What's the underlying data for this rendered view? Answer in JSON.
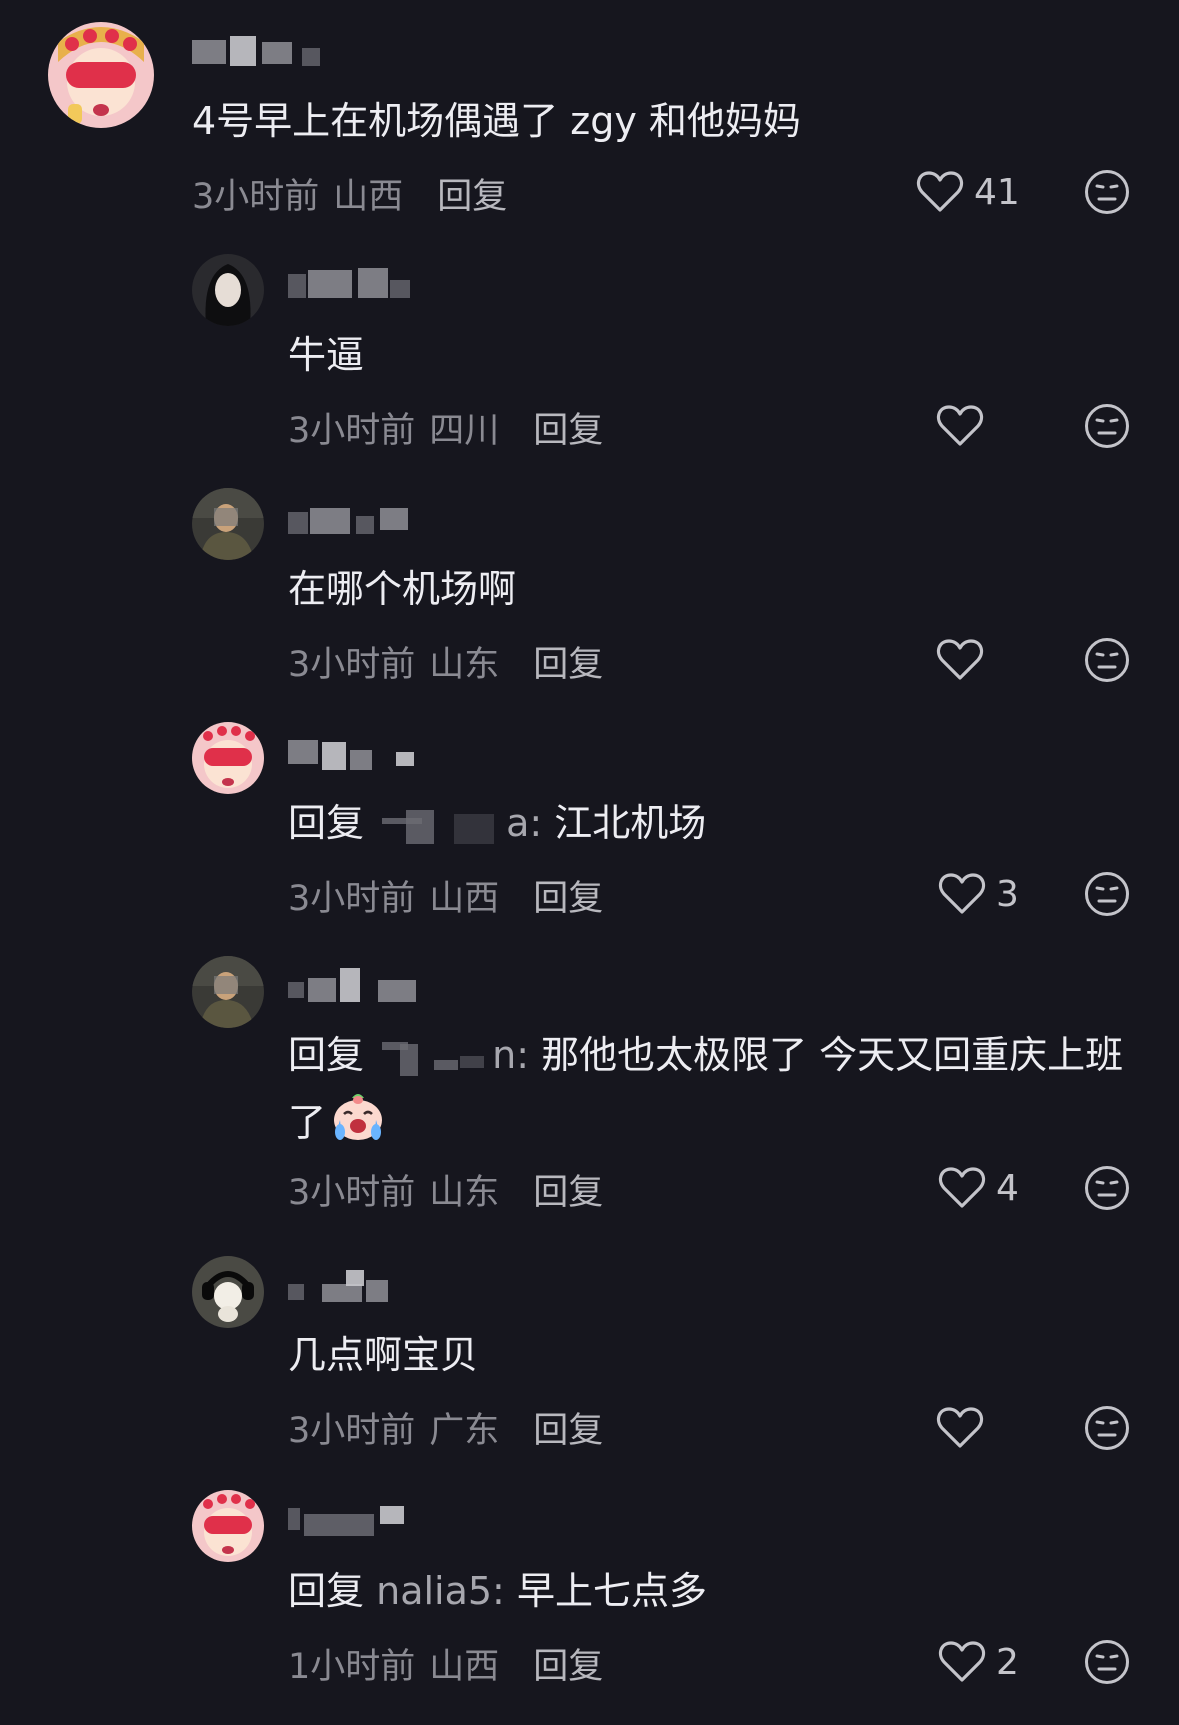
{
  "comments": [
    {
      "text": "4号早上在机场偶遇了 zgy 和他妈妈",
      "time": "3小时前",
      "location": "山西",
      "reply_label": "回复",
      "likes": "41"
    }
  ],
  "replies": [
    {
      "text": "牛逼",
      "time": "3小时前",
      "location": "四川",
      "reply_label": "回复",
      "likes": ""
    },
    {
      "text": "在哪个机场啊",
      "time": "3小时前",
      "location": "山东",
      "reply_label": "回复",
      "likes": ""
    },
    {
      "prefix": "回复",
      "mention_suffix": "a: ",
      "text": "江北机场",
      "time": "3小时前",
      "location": "山西",
      "reply_label": "回复",
      "likes": "3"
    },
    {
      "prefix": "回复",
      "mention_suffix": "n: ",
      "text": "那他也太极限了 今天又回重庆上班了",
      "emoji": "crying-face-emoji",
      "time": "3小时前",
      "location": "山东",
      "reply_label": "回复",
      "likes": "4"
    },
    {
      "text": "几点啊宝贝",
      "time": "3小时前",
      "location": "广东",
      "reply_label": "回复",
      "likes": ""
    },
    {
      "prefix": "回复",
      "mention": "nalia5: ",
      "text": "早上七点多",
      "time": "1小时前",
      "location": "山西",
      "reply_label": "回复",
      "likes": "2"
    }
  ],
  "icons": {
    "like": "heart-outline-icon",
    "dislike": "neutral-face-icon"
  },
  "colors": {
    "background": "#16161e",
    "text": "#ededf2",
    "meta": "#8a8a92"
  }
}
